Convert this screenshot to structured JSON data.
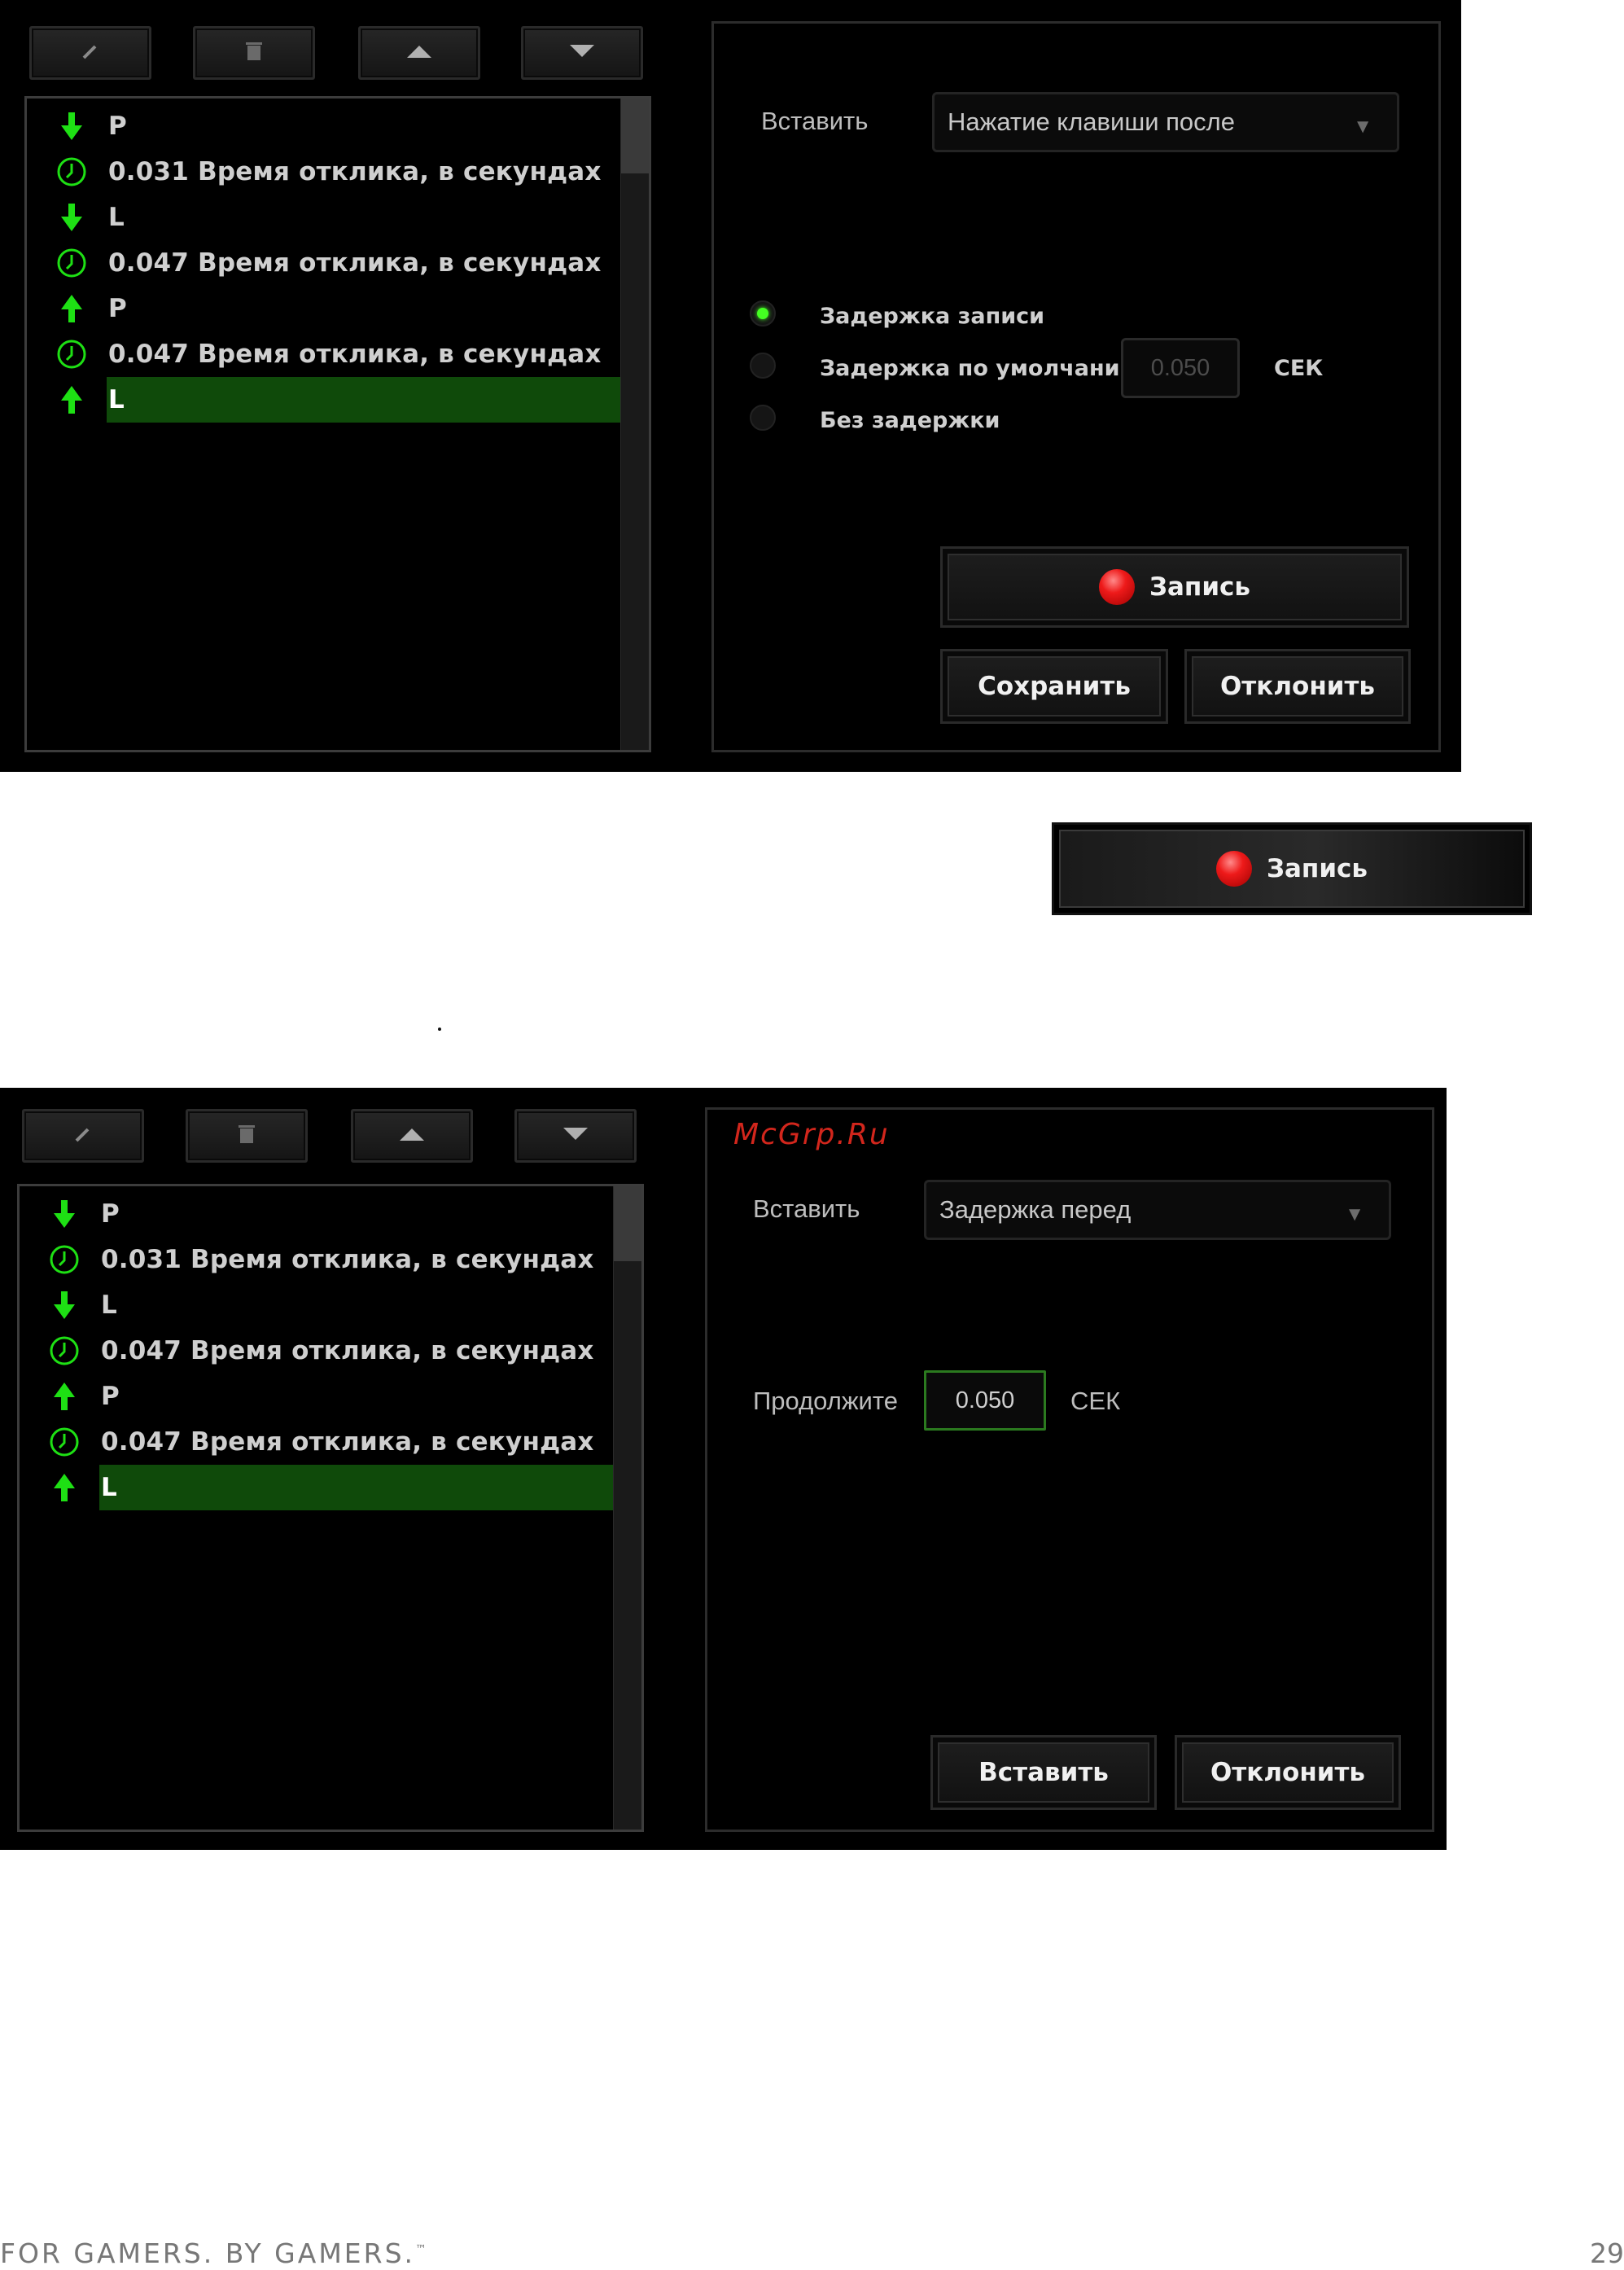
{
  "panel1": {
    "toolbar": [
      "edit-icon",
      "delete-icon",
      "move-up-icon",
      "move-down-icon"
    ],
    "events": [
      {
        "icon": "arrow-down-icon",
        "text": "P"
      },
      {
        "icon": "clock-icon",
        "text": "0.031 Время отклика, в секундах"
      },
      {
        "icon": "arrow-down-icon",
        "text": "L"
      },
      {
        "icon": "clock-icon",
        "text": "0.047 Время отклика, в секундах"
      },
      {
        "icon": "arrow-up-icon",
        "text": "P"
      },
      {
        "icon": "clock-icon",
        "text": "0.047 Время отклика, в секундах"
      },
      {
        "icon": "arrow-up-icon",
        "text": "L",
        "selected": true
      }
    ],
    "insert_label": "Вставить",
    "insert_value": "Нажатие клавиши после",
    "radios": [
      {
        "label": "Задержка записи",
        "checked": true
      },
      {
        "label": "Задержка по умолчанию",
        "checked": false
      },
      {
        "label": "Без задержки",
        "checked": false
      }
    ],
    "default_delay": "0.050",
    "unit": "СЕК",
    "record_label": "Запись",
    "save_label": "Сохранить",
    "cancel_label": "Отклонить"
  },
  "record_button": {
    "label": "Запись"
  },
  "panel2": {
    "toolbar": [
      "edit-icon",
      "delete-icon",
      "move-up-icon",
      "move-down-icon"
    ],
    "watermark": "McGrp.Ru",
    "events": [
      {
        "icon": "arrow-down-icon",
        "text": "P"
      },
      {
        "icon": "clock-icon",
        "text": "0.031 Время отклика, в секундах"
      },
      {
        "icon": "arrow-down-icon",
        "text": "L"
      },
      {
        "icon": "clock-icon",
        "text": "0.047 Время отклика, в секундах"
      },
      {
        "icon": "arrow-up-icon",
        "text": "P"
      },
      {
        "icon": "clock-icon",
        "text": "0.047 Время отклика, в секундах"
      },
      {
        "icon": "arrow-up-icon",
        "text": "L",
        "selected": true
      }
    ],
    "insert_label": "Вставить",
    "insert_value": "Задержка перед",
    "duration_label": "Продолжите",
    "duration_value": "0.050",
    "unit": "СЕК",
    "insert_button": "Вставить",
    "cancel_label": "Отклонить"
  },
  "footer": {
    "slogan": "FOR GAMERS. BY GAMERS.",
    "tm": "™",
    "page": "29"
  },
  "colors": {
    "accent": "#44ff22",
    "selection": "#0f4a0a",
    "record": "#ee1a1a",
    "watermark": "#d2261c"
  }
}
